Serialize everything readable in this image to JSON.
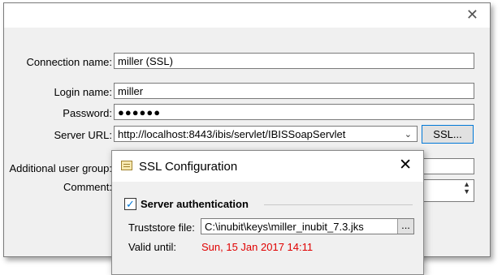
{
  "main": {
    "close_glyph": "✕",
    "connection_name": {
      "label": "Connection name:",
      "value": "miller (SSL)"
    },
    "login_name": {
      "label": "Login name:",
      "value": "miller"
    },
    "password": {
      "label": "Password:",
      "value": "●●●●●●"
    },
    "server_url": {
      "label": "Server URL:",
      "value": "http://localhost:8443/ibis/servlet/IBISSoapServlet",
      "ssl_button": "SSL..."
    },
    "additional_user_group": {
      "label": "Additional user group:"
    },
    "comment": {
      "label": "Comment:"
    }
  },
  "ssl_dialog": {
    "title": "SSL Configuration",
    "close_glyph": "✕",
    "server_authentication": {
      "label": "Server authentication",
      "checked": true
    },
    "truststore": {
      "label": "Truststore file:",
      "value": "C:\\inubit\\keys\\miller_inubit_7.3.jks",
      "browse_label": "..."
    },
    "valid_until": {
      "label": "Valid until:",
      "value": "Sun, 15 Jan 2017 14:11",
      "color": "#e00000"
    }
  },
  "icons": [
    "close-icon",
    "dropdown-chevron-icon",
    "spinner-icon",
    "dialog-icon",
    "checkmark-icon"
  ]
}
